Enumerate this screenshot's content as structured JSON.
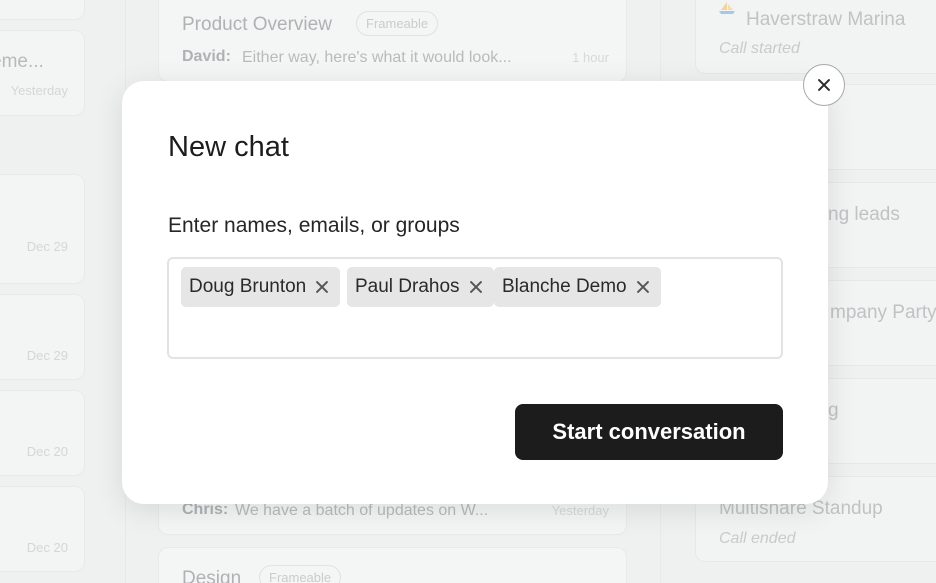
{
  "background": {
    "left_cards": [
      {
        "title": "",
        "time": ""
      },
      {
        "title": "eme...",
        "time": "Yesterday"
      },
      {
        "title": "",
        "time": "Dec 29"
      },
      {
        "title": "",
        "time": "Dec 29"
      },
      {
        "title": "",
        "time": "Dec 20"
      },
      {
        "title": "",
        "time": "Dec 20"
      }
    ],
    "middle_cards": [
      {
        "title": "Product Overview",
        "tag": "Frameable",
        "sender": "David:",
        "snippet": "Either way, here's what it would look...",
        "time": "1 hour"
      },
      {
        "title": "",
        "tag": "",
        "sender": "Chris:",
        "snippet": "We have a batch of updates on W...",
        "time": "Yesterday"
      },
      {
        "title": "Design",
        "tag": "Frameable",
        "sender": "",
        "snippet": "",
        "time": ""
      }
    ],
    "right_cards": [
      {
        "title": "Haverstraw Marina",
        "subtitle": "Call started",
        "icon": "sailboat-icon"
      },
      {
        "title": "",
        "subtitle": ""
      },
      {
        "title": "ng leads",
        "subtitle": ""
      },
      {
        "title": "mpany Party (",
        "subtitle": ""
      },
      {
        "title": "g",
        "subtitle": ""
      },
      {
        "title": "Multishare Standup",
        "subtitle": "Call ended"
      }
    ]
  },
  "modal": {
    "title": "New chat",
    "field_label": "Enter names, emails, or groups",
    "recipients": [
      {
        "label": "Doug Brunton"
      },
      {
        "label": "Paul Drahos"
      },
      {
        "label": "Blanche Demo"
      }
    ],
    "start_button_label": "Start conversation",
    "close_icon": "close-icon"
  },
  "colors": {
    "primary_button": "#1c1c1c",
    "chip_background": "#e6e6e6",
    "page_background": "#eef0f0"
  }
}
